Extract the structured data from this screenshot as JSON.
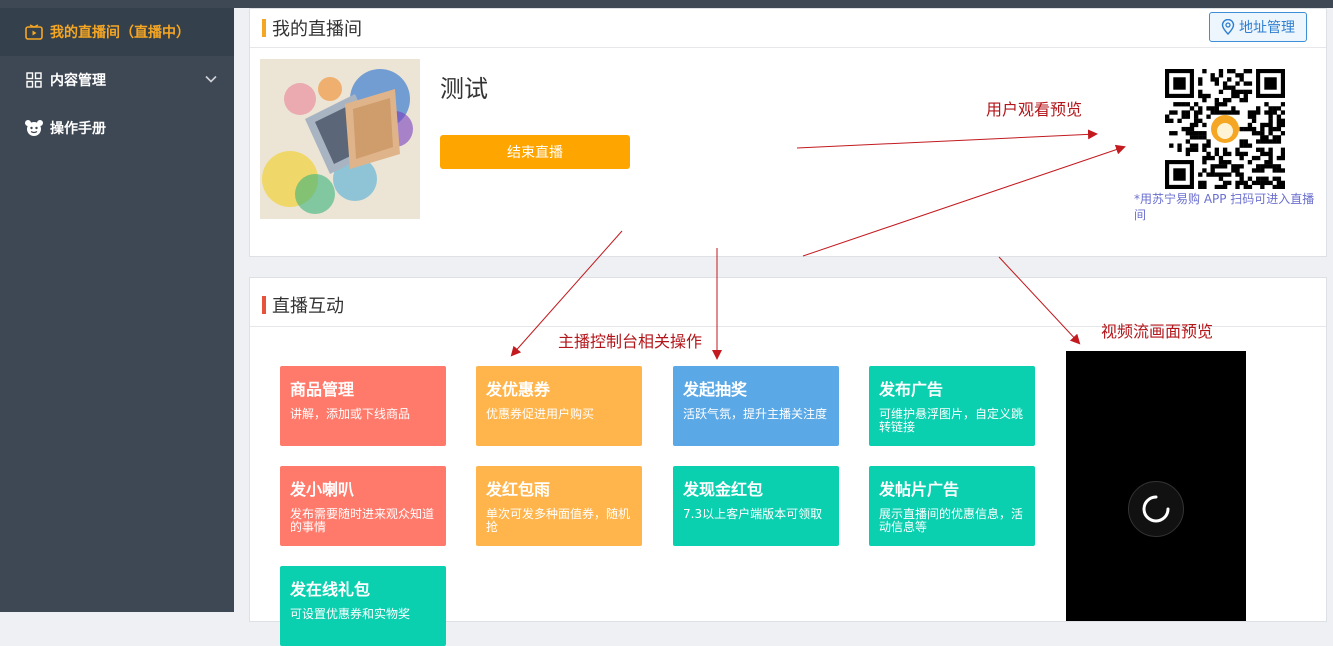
{
  "sidebar": {
    "items": [
      {
        "label": "我的直播间（直播中）",
        "icon": "tv-icon"
      },
      {
        "label": "内容管理",
        "icon": "grid-icon"
      },
      {
        "label": "操作手册",
        "icon": "mascot-icon"
      }
    ]
  },
  "room": {
    "title": "我的直播间",
    "address_button": "地址管理",
    "live_name": "测试",
    "end_button": "结束直播",
    "qr_note": "*用苏宁易购 APP 扫码可进入直播间"
  },
  "interact": {
    "title": "直播互动",
    "tiles": [
      {
        "title": "商品管理",
        "desc": "讲解，添加或下线商品",
        "color": "#ff7a6b"
      },
      {
        "title": "发优惠券",
        "desc": "优惠券促进用户购买",
        "color": "#ffb54c"
      },
      {
        "title": "发起抽奖",
        "desc": "活跃气氛，提升主播关注度",
        "color": "#5aa8e6"
      },
      {
        "title": "发布广告",
        "desc": "可维护悬浮图片，自定义跳转链接",
        "color": "#0bd0b0"
      },
      {
        "title": "发小喇叭",
        "desc": "发布需要随时进来观众知道的事情",
        "color": "#ff7a6b"
      },
      {
        "title": "发红包雨",
        "desc": "单次可发多种面值券，随机抢",
        "color": "#ffb54c"
      },
      {
        "title": "发现金红包",
        "desc": "7.3以上客户端版本可领取",
        "color": "#0bd0b0"
      },
      {
        "title": "发帖片广告",
        "desc": "展示直播间的优惠信息，活动信息等",
        "color": "#0bd0b0"
      },
      {
        "title": "发在线礼包",
        "desc": "可设置优惠券和实物奖",
        "color": "#0bd0b0"
      }
    ]
  },
  "annotations": {
    "user_preview": "用户观看预览",
    "console_ops": "主播控制台相关操作",
    "stream_preview": "视频流画面预览"
  },
  "colors": {
    "sidebar_bg": "#3e4855",
    "active": "#f5a623",
    "end_button": "#ffa500",
    "annotation": "#b3161a"
  }
}
